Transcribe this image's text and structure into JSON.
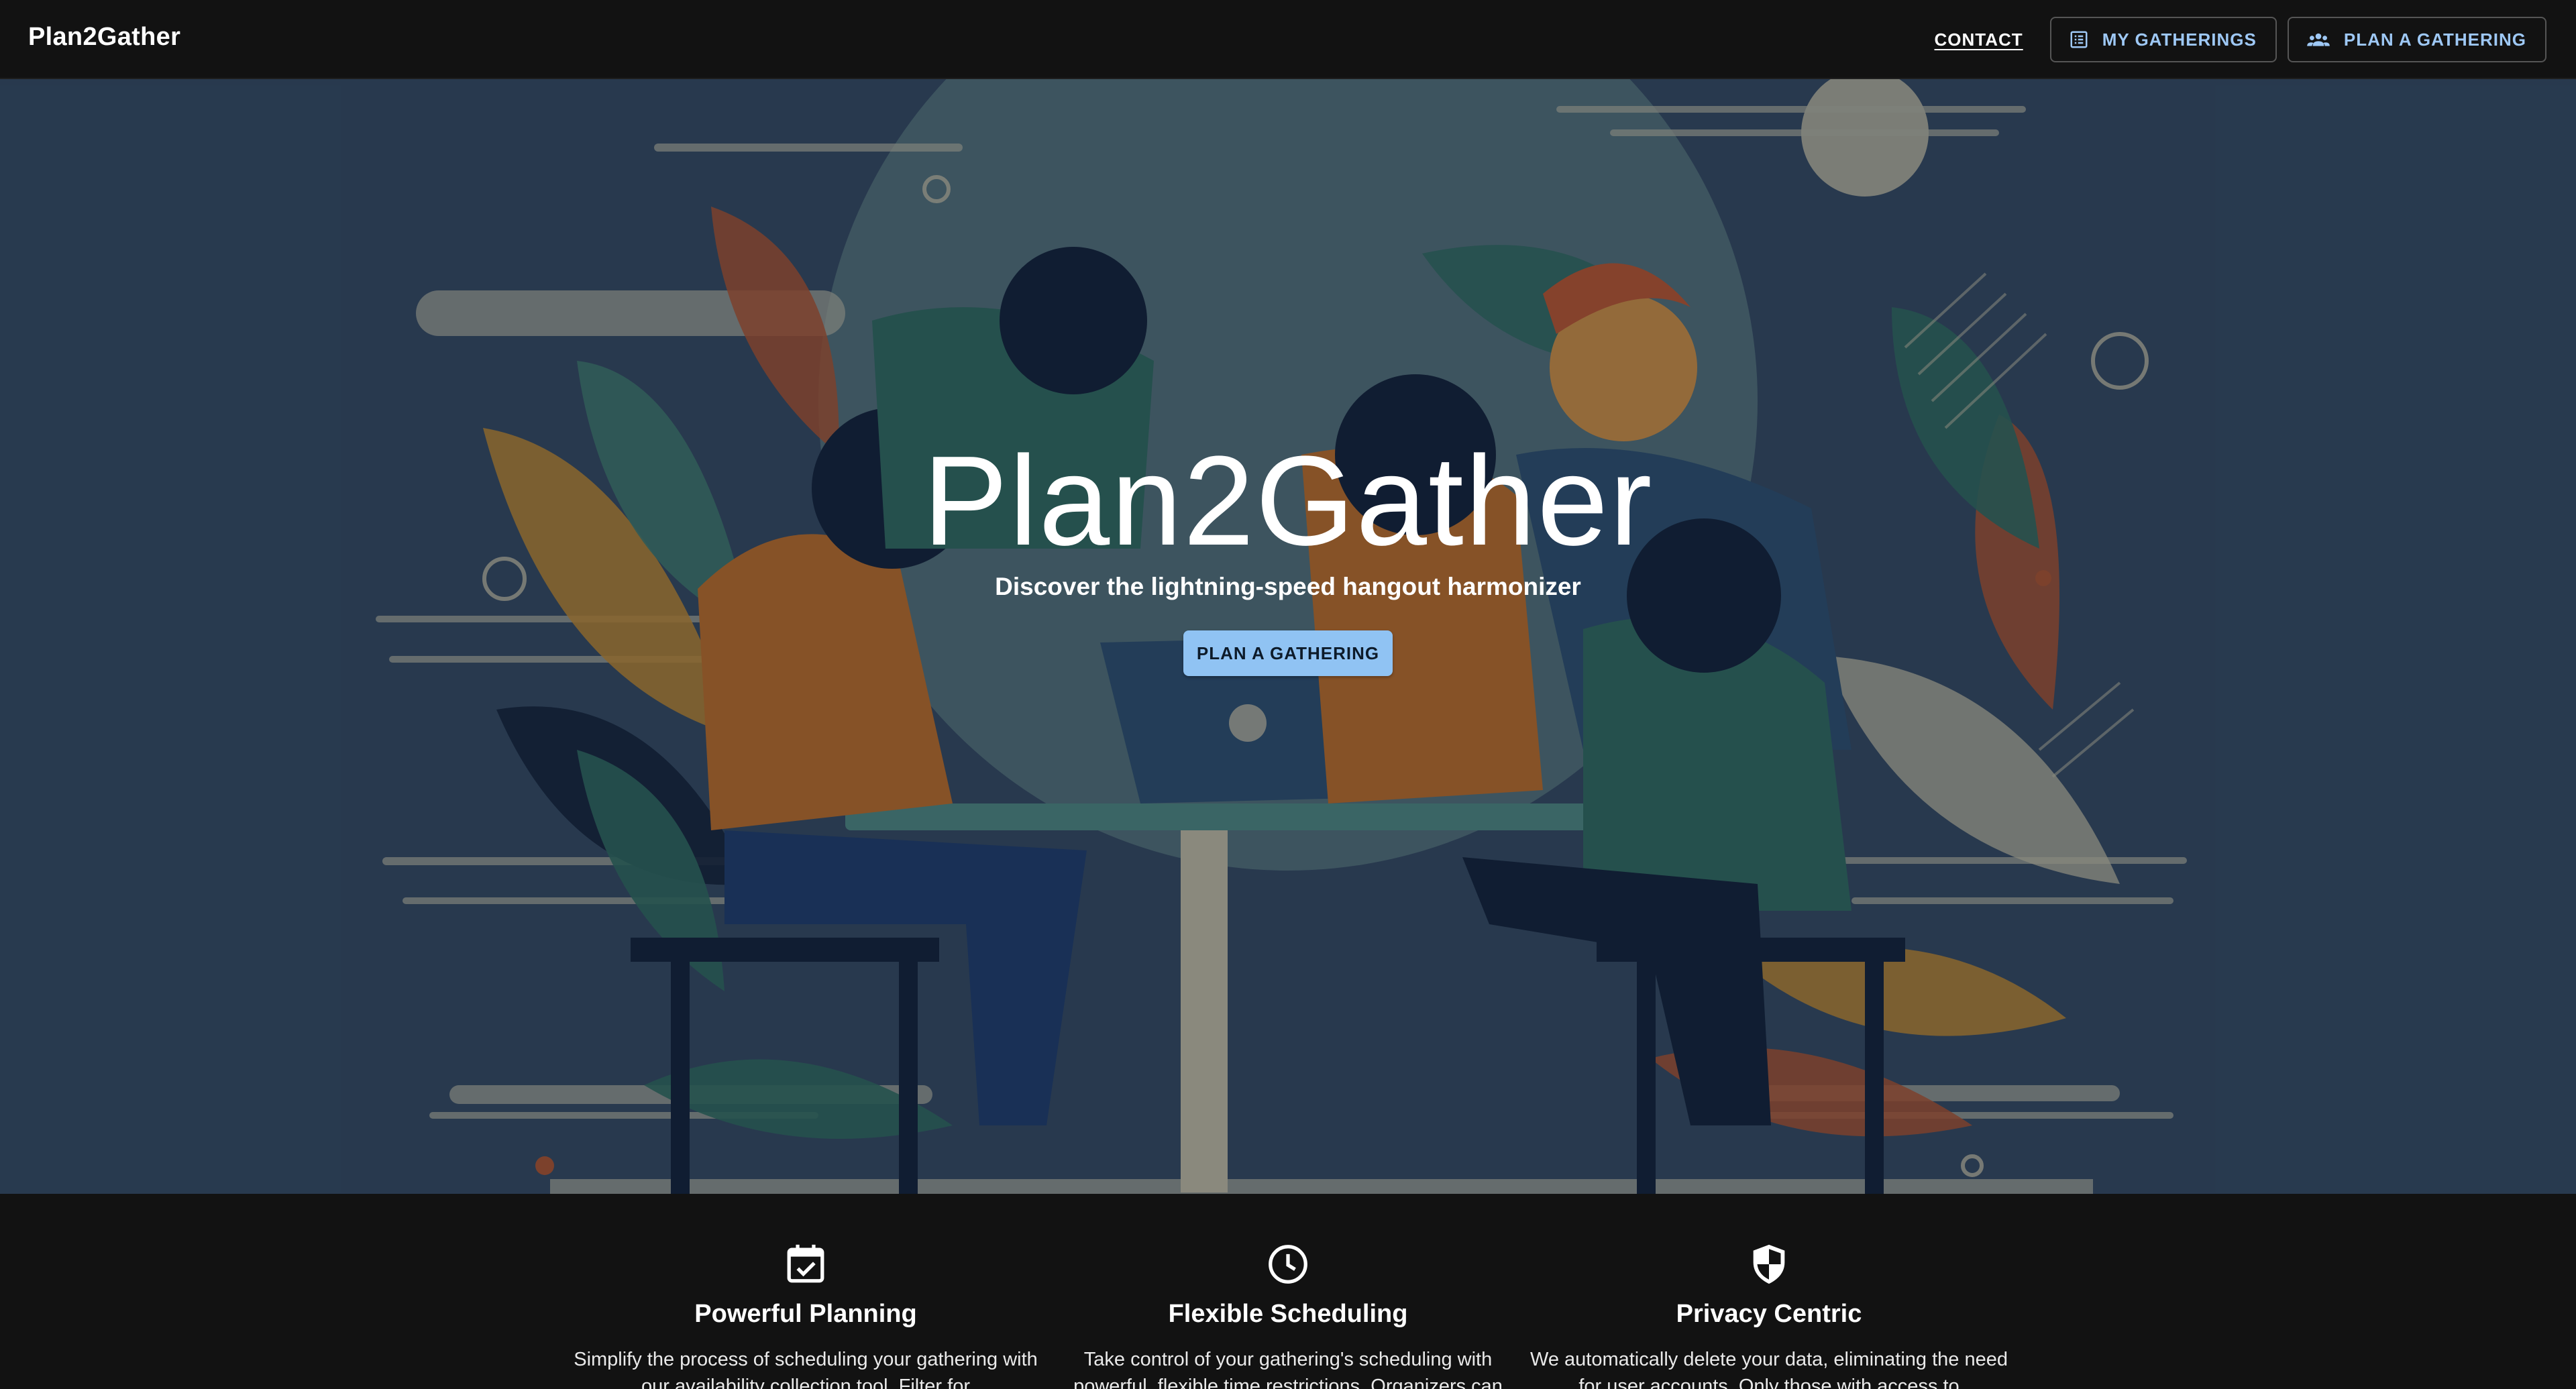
{
  "app": {
    "brand": "Plan2Gather"
  },
  "nav": {
    "contact_label": "CONTACT",
    "my_gatherings_label": "MY GATHERINGS",
    "plan_gathering_label": "PLAN A GATHERING"
  },
  "hero": {
    "title": "Plan2Gather",
    "subtitle": "Discover the lightning-speed hangout harmonizer",
    "cta_label": "PLAN A GATHERING"
  },
  "features": [
    {
      "icon": "calendar-check-icon",
      "title": "Powerful Planning",
      "description": "Simplify the process of scheduling your gathering with our availability collection tool. Filter for"
    },
    {
      "icon": "clock-icon",
      "title": "Flexible Scheduling",
      "description": "Take control of your gathering's scheduling with powerful, flexible time restrictions. Organizers can"
    },
    {
      "icon": "shield-icon",
      "title": "Privacy Centric",
      "description": "We automatically delete your data, eliminating the need for user accounts. Only those with access to"
    }
  ],
  "colors": {
    "appbar_bg": "#121212",
    "hero_bg": "#33485f",
    "accent": "#90c3f3",
    "outlined_text": "#9ec8f5"
  }
}
